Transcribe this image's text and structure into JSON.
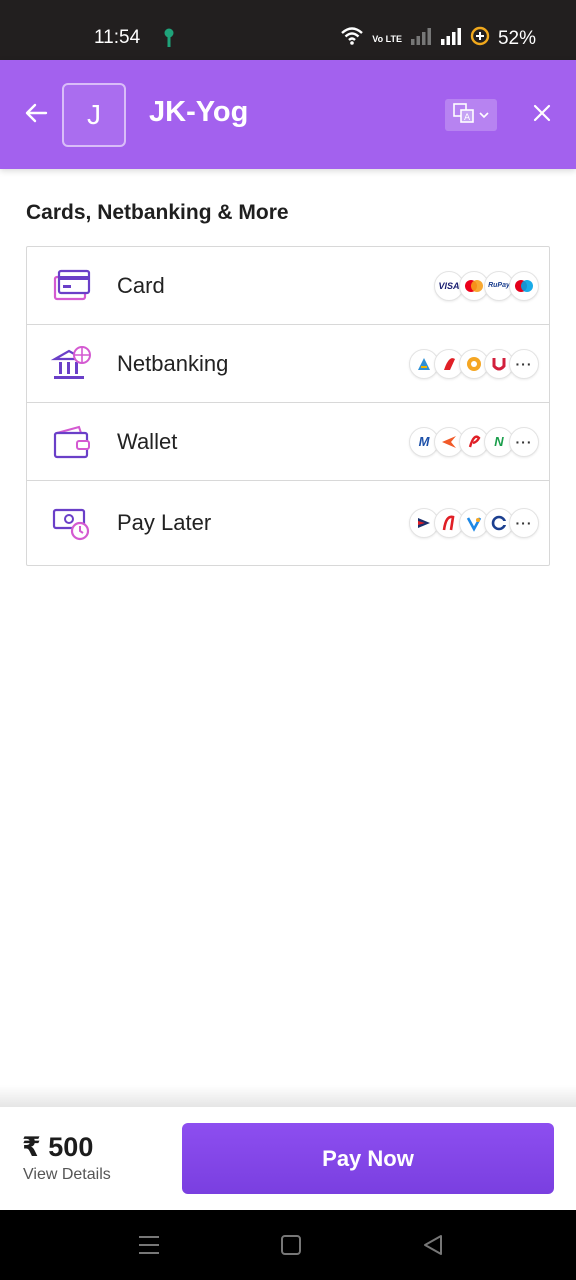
{
  "status_bar": {
    "time": "11:54",
    "network_label": "Vo LTE",
    "battery": "52%"
  },
  "header": {
    "logo_letter": "J",
    "merchant_name": "JK-Yog",
    "accent_color": "#a361ee"
  },
  "section": {
    "title": "Cards, Netbanking & More"
  },
  "methods": [
    {
      "label": "Card",
      "icon": "card-icon",
      "badges": [
        "VISA",
        "Mastercard",
        "RuPay",
        "Maestro"
      ]
    },
    {
      "label": "Netbanking",
      "icon": "bank-icon",
      "badges": [
        "bank-1",
        "bank-2",
        "bank-3",
        "bank-4"
      ],
      "more": "···"
    },
    {
      "label": "Wallet",
      "icon": "wallet-icon",
      "badges": [
        "wallet-1",
        "wallet-2",
        "wallet-3",
        "wallet-4"
      ],
      "more": "···"
    },
    {
      "label": "Pay Later",
      "icon": "paylater-icon",
      "badges": [
        "paylater-1",
        "paylater-2",
        "paylater-3",
        "paylater-4"
      ],
      "more": "···"
    }
  ],
  "footer": {
    "amount": "₹ 500",
    "view_details": "View Details",
    "pay_button": "Pay Now"
  }
}
